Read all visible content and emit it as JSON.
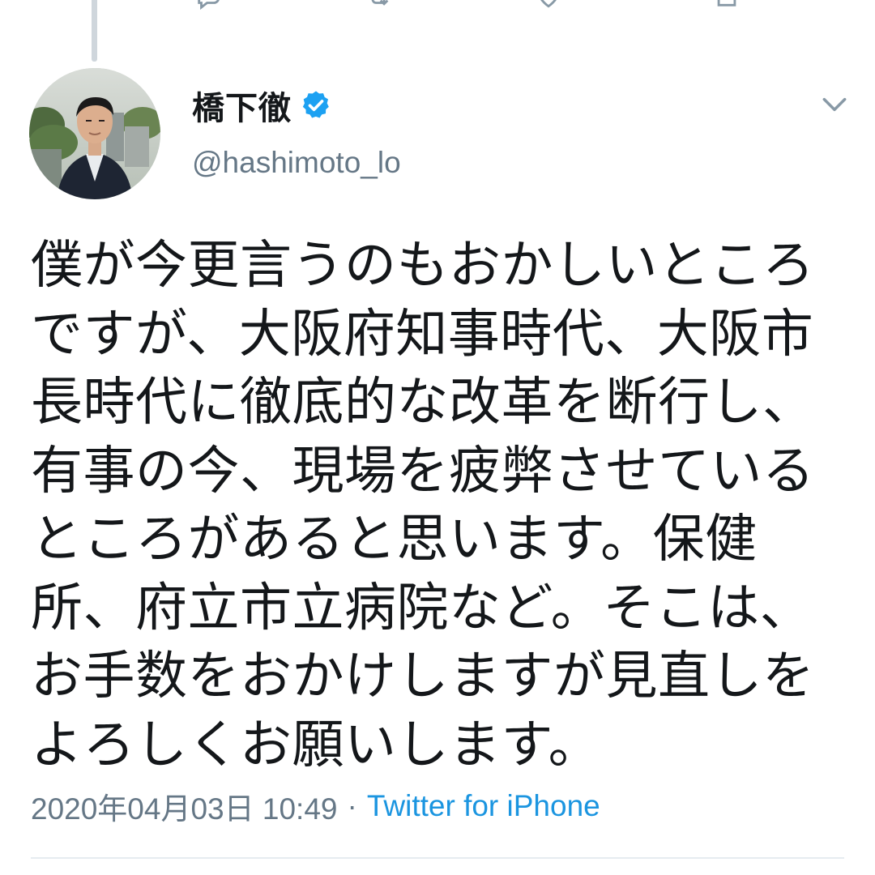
{
  "tweet": {
    "display_name": "橋下徹",
    "handle": "@hashimoto_lo",
    "text": "僕が今更言うのもおかしいところですが、大阪府知事時代、大阪市長時代に徹底的な改革を断行し、有事の今、現場を疲弊させているところがあると思います。保健所、府立市立病院など。そこは、お手数をおかけしますが見直しをよろしくお願いします。",
    "timestamp": "2020年04月03日 10:49",
    "separator": "·",
    "source": "Twitter for iPhone",
    "verified": true
  },
  "icons": {
    "verified": "verified-badge-icon",
    "menu": "chevron-down-icon",
    "reply": "reply-icon",
    "retweet": "retweet-icon",
    "like": "heart-icon",
    "share": "share-icon"
  },
  "colors": {
    "text": "#14171a",
    "secondary": "#657786",
    "link": "#1b95e0",
    "verified": "#1da1f2",
    "divider": "#e6ecf0"
  }
}
